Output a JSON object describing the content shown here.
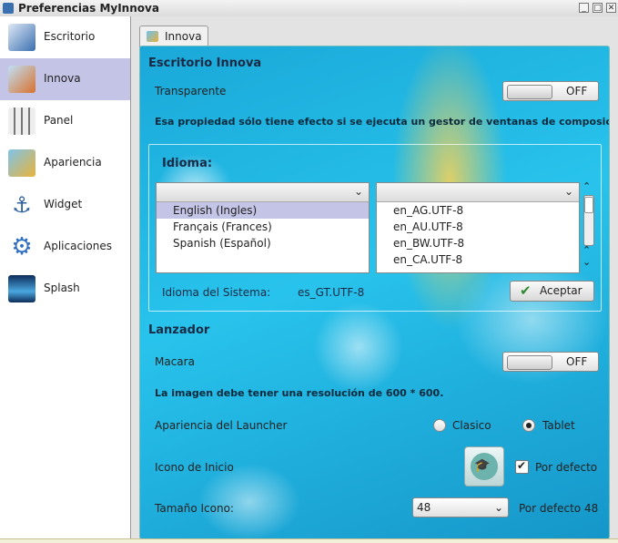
{
  "window": {
    "title": "Preferencias MyInnova",
    "buttons": {
      "minimize": "_",
      "maximize": "□",
      "close": "✕"
    }
  },
  "sidebar": {
    "items": [
      {
        "label": "Escritorio",
        "icon": "desktop-icon",
        "color": "#3a6fb0"
      },
      {
        "label": "Innova",
        "icon": "innova-icon",
        "color": "#d9722e"
      },
      {
        "label": "Panel",
        "icon": "panel-sliders-icon",
        "color": "#777777"
      },
      {
        "label": "Apariencia",
        "icon": "appearance-icon",
        "color": "#e8b33a"
      },
      {
        "label": "Widget",
        "icon": "anchor-icon",
        "color": "#2f5f9e"
      },
      {
        "label": "Aplicaciones",
        "icon": "gear-icon",
        "color": "#2f6fbf"
      },
      {
        "label": "Splash",
        "icon": "splash-icon",
        "color": "#1c4f8c"
      }
    ],
    "active_index": 1,
    "active_color": "#c4c4e6"
  },
  "tab": {
    "label": "Innova"
  },
  "escritorio": {
    "heading": "Escritorio Innova",
    "transparente_label": "Transparente",
    "transparente_state": "OFF",
    "note": "Esa propiedad sólo tiene efecto si se ejecuta un gestor de ventanas de composici"
  },
  "idioma": {
    "heading": "Idioma:",
    "languages": [
      "English (Ingles)",
      "Français (Frances)",
      "Spanish (Español)"
    ],
    "selected_language": "English (Ingles)",
    "locales": [
      "en_AG.UTF-8",
      "en_AU.UTF-8",
      "en_BW.UTF-8",
      "en_CA.UTF-8"
    ],
    "system_label": "Idioma del Sistema:",
    "system_value": "es_GT.UTF-8",
    "accept_label": "Aceptar"
  },
  "lanzador": {
    "heading": "Lanzador",
    "macara_label": "Macara",
    "macara_state": "OFF",
    "note": "La imagen debe tener una resolución de 600 * 600.",
    "apariencia_label": "Apariencia del Launcher",
    "options": [
      "Clasico",
      "Tablet"
    ],
    "selected_option": "Tablet",
    "icono_label": "Icono de Inicio",
    "por_defecto_label": "Por defecto",
    "por_defecto_checked": true,
    "tamano_label": "Tamaño Icono:",
    "tamano_value": "48",
    "tamano_default": "Por defecto 48"
  }
}
